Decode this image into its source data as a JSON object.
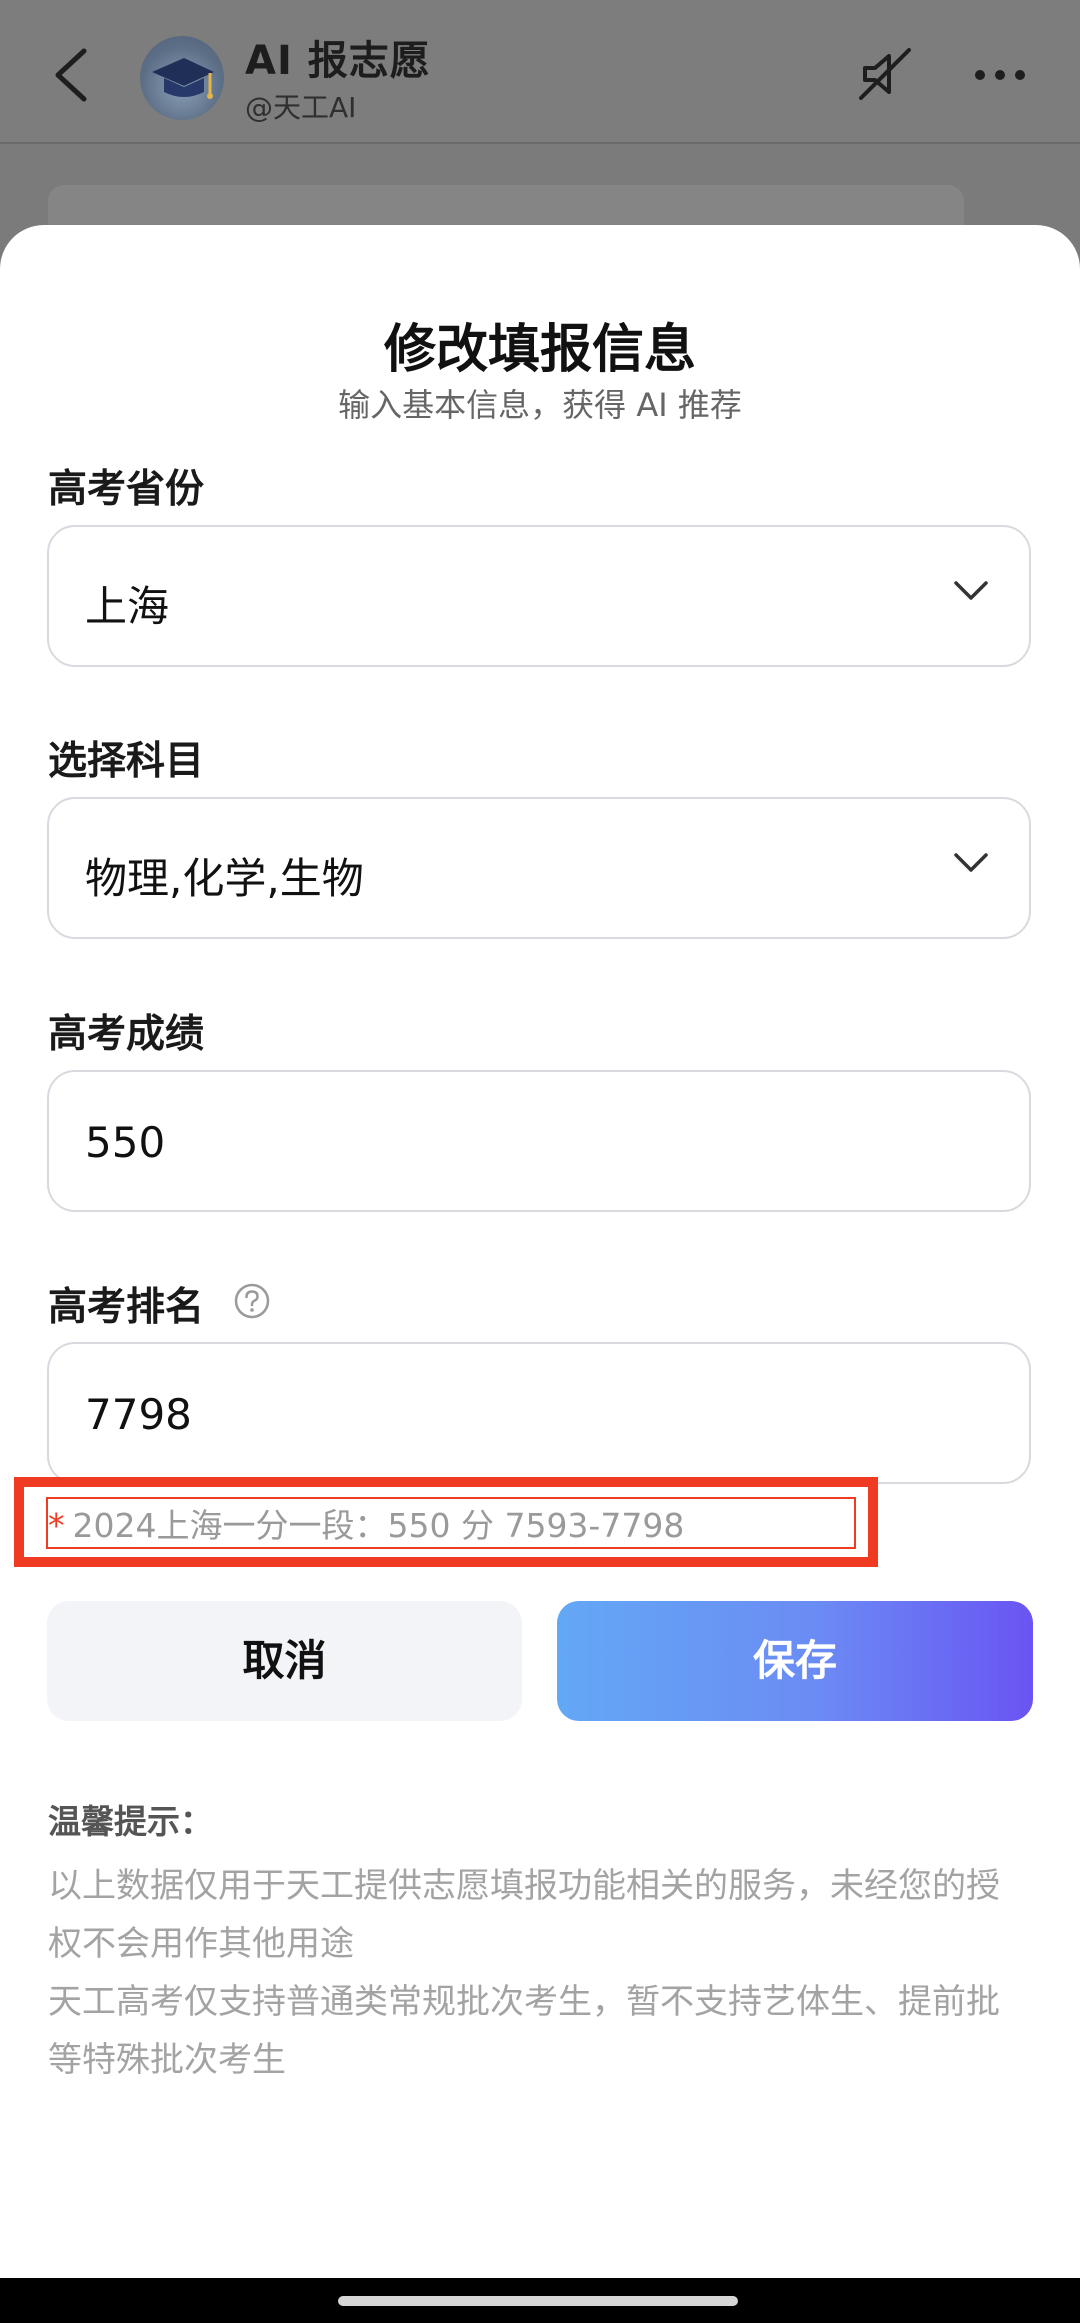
{
  "header": {
    "title": "AI 报志愿",
    "handle": "@天工AI"
  },
  "sheet": {
    "title": "修改填报信息",
    "subtitle": "输入基本信息，获得 AI 推荐"
  },
  "form": {
    "province": {
      "label": "高考省份",
      "value": "上海"
    },
    "subjects": {
      "label": "选择科目",
      "value": "物理,化学,生物"
    },
    "score": {
      "label": "高考成绩",
      "value": "550"
    },
    "rank": {
      "label": "高考排名",
      "value": "7798"
    }
  },
  "hint": {
    "star": "*",
    "text": "2024上海一分一段：550 分 7593-7798"
  },
  "buttons": {
    "cancel": "取消",
    "save": "保存"
  },
  "tips": {
    "title": "温馨提示：",
    "line1": "以上数据仅用于天工提供志愿填报功能相关的服务，未经您的授权不会用作其他用途",
    "line2": "天工高考仅支持普通类常规批次考生，暂不支持艺体生、提前批等特殊批次考生"
  },
  "colors": {
    "highlight": "#ee3b22",
    "save_gradient_start": "#63a8f5",
    "save_gradient_end": "#6a54f3"
  }
}
